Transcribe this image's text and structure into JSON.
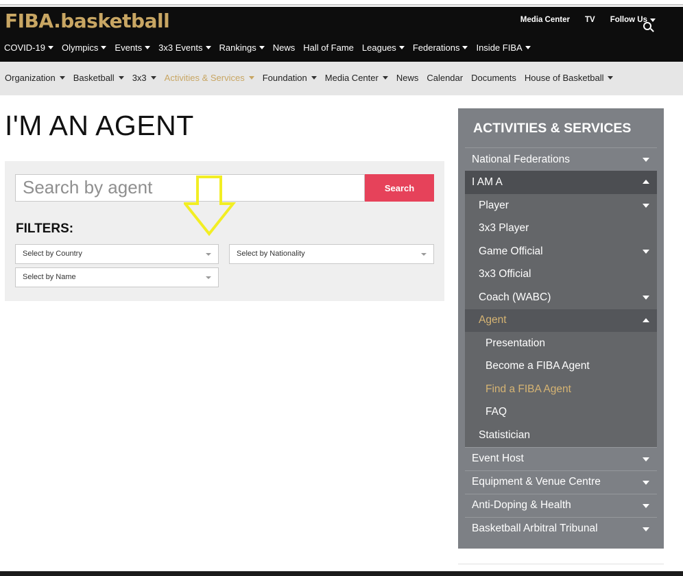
{
  "brand": {
    "logo_text": "FIBA.basketball",
    "accent": "#c8a663"
  },
  "utility_nav": [
    "Media Center",
    "TV",
    "Follow Us"
  ],
  "main_nav": [
    "COVID-19",
    "Olympics",
    "Events",
    "3x3 Events",
    "Rankings",
    "News",
    "Hall of Fame",
    "Leagues",
    "Federations",
    "Inside FIBA"
  ],
  "sub_nav": [
    "Organization",
    "Basketball",
    "3x3",
    "Activities & Services",
    "Foundation",
    "Media Center",
    "News",
    "Calendar",
    "Documents",
    "House of Basketball"
  ],
  "page": {
    "title": "I'M AN AGENT"
  },
  "search": {
    "placeholder": "Search by agent",
    "button_label": "Search",
    "button_color": "#e6425a"
  },
  "filters": {
    "label": "FILTERS:",
    "country": "Select by Country",
    "nationality": "Select by Nationality",
    "name": "Select by Name"
  },
  "sidebar": {
    "title": "ACTIVITIES & SERVICES",
    "items": [
      "National Federations",
      "I AM A",
      "Player",
      "3x3 Player",
      "Game Official",
      "3x3 Official",
      "Coach (WABC)",
      "Agent",
      "Presentation",
      "Become a FIBA Agent",
      "Find a FIBA Agent",
      "FAQ",
      "Statistician",
      "Event Host",
      "Equipment & Venue Centre",
      "Anti-Doping & Health",
      "Basketball Arbitral Tribunal"
    ]
  }
}
